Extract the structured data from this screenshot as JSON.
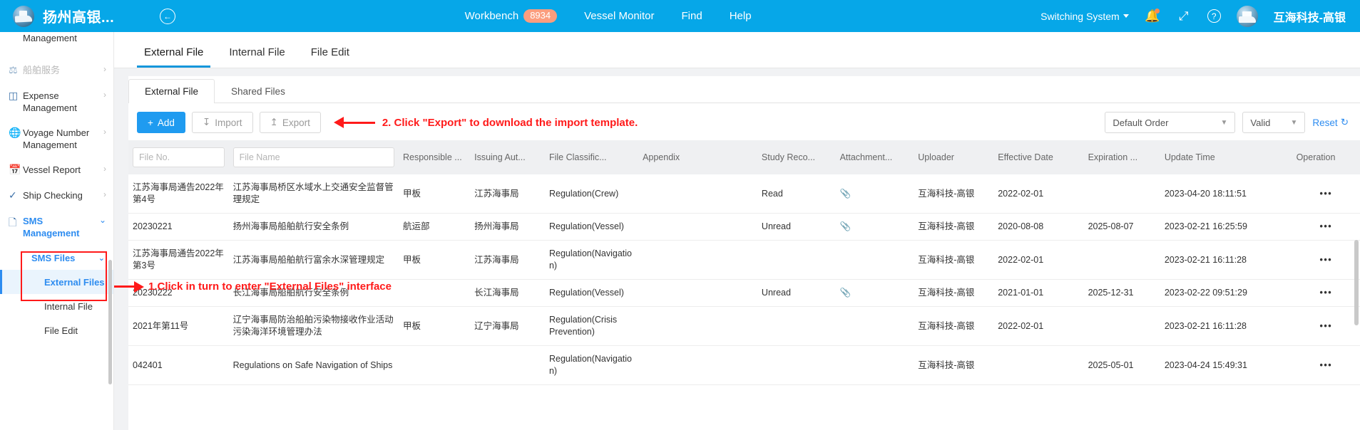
{
  "topbar": {
    "brand_name": "扬州高银...",
    "collapse_icon": "arrow-left-circle-icon",
    "nav": [
      {
        "label": "Workbench",
        "badge": "8934"
      },
      {
        "label": "Vessel Monitor",
        "badge": ""
      },
      {
        "label": "Find",
        "badge": ""
      },
      {
        "label": "Help",
        "badge": ""
      }
    ],
    "switch_system": "Switching System",
    "bell_icon": "bell-icon",
    "expand_icon": "fullscreen-icon",
    "help_icon": "question-circle-icon",
    "user_name": "互海科技-高银",
    "accent": "#06A7E8",
    "badge_color": "#FB9D7E"
  },
  "sidebar": {
    "items": [
      {
        "label": "Management",
        "icon": "",
        "arrow": "",
        "muted": false,
        "continuation": true
      },
      {
        "label": "船舶服务",
        "icon": "tool-icon",
        "arrow": "›",
        "muted": true,
        "continuation": false
      },
      {
        "label": "Expense Management",
        "icon": "database-icon",
        "arrow": "›",
        "muted": false,
        "continuation": false
      },
      {
        "label": "Voyage Number Management",
        "icon": "globe-icon",
        "arrow": "›",
        "muted": false,
        "continuation": false
      },
      {
        "label": "Vessel Report",
        "icon": "calendar-icon",
        "arrow": "›",
        "muted": false,
        "continuation": false
      },
      {
        "label": "Ship Checking",
        "icon": "check-circle-icon",
        "arrow": "›",
        "muted": false,
        "continuation": false
      }
    ],
    "sms_group": {
      "label": "SMS Management",
      "icon": "files-icon",
      "chevron": "⌄"
    },
    "sms_files": {
      "label": "SMS Files",
      "chevron": "⌄"
    },
    "leaves": [
      {
        "label": "External Files",
        "selected": true
      },
      {
        "label": "Internal File",
        "selected": false
      },
      {
        "label": "File Edit",
        "selected": false
      }
    ]
  },
  "page_tabs": [
    {
      "label": "External File",
      "active": true
    },
    {
      "label": "Internal File",
      "active": false
    },
    {
      "label": "File Edit",
      "active": false
    }
  ],
  "card_tabs": [
    {
      "label": "External File",
      "active": true
    },
    {
      "label": "Shared Files",
      "active": false
    }
  ],
  "toolbar": {
    "add_label": "Add",
    "add_icon": "plus-icon",
    "import_label": "Import",
    "import_icon": "download-icon",
    "export_label": "Export",
    "export_icon": "upload-icon",
    "sort_value": "Default Order",
    "status_value": "Valid",
    "reset_label": "Reset",
    "reset_icon": "refresh-icon"
  },
  "annotations": {
    "step1": "1.Click in turn to enter \"External Files\" interface",
    "step2": "2. Click \"Export\" to download the import template.",
    "color": "#ff1a1a"
  },
  "table": {
    "headers": [
      "File No.",
      "File Name",
      "Responsible ...",
      "Issuing Aut...",
      "File Classific...",
      "Appendix",
      "Study Reco...",
      "Attachment...",
      "Uploader",
      "Effective Date",
      "Expiration ...",
      "Update Time",
      "Operation"
    ],
    "filter_placeholders": {
      "file_no": "File No.",
      "file_name": "File Name"
    },
    "rows": [
      {
        "file_no": "江苏海事局通告2022年第4号",
        "file_name": "江苏海事局桥区水域水上交通安全监督管理规定",
        "responsible": "甲板",
        "issuing_authority": "江苏海事局",
        "classification": "Regulation(Crew)",
        "appendix": "",
        "study_record": "Read",
        "attachment": "paperclip-icon",
        "uploader": "互海科技-高银",
        "effective_date": "2022-02-01",
        "expiration_date": "",
        "update_time": "2023-04-20 18:11:51",
        "operation": "•••"
      },
      {
        "file_no": "20230221",
        "file_name": "扬州海事局船舶航行安全条例",
        "responsible": "航运部",
        "issuing_authority": "扬州海事局",
        "classification": "Regulation(Vessel)",
        "appendix": "",
        "study_record": "Unread",
        "attachment": "paperclip-icon",
        "uploader": "互海科技-高银",
        "effective_date": "2020-08-08",
        "expiration_date": "2025-08-07",
        "update_time": "2023-02-21 16:25:59",
        "operation": "•••"
      },
      {
        "file_no": "江苏海事局通告2022年第3号",
        "file_name": "江苏海事局船舶航行富余水深管理规定",
        "responsible": "甲板",
        "issuing_authority": "江苏海事局",
        "classification": "Regulation(Navigation)",
        "appendix": "",
        "study_record": "",
        "attachment": "",
        "uploader": "互海科技-高银",
        "effective_date": "2022-02-01",
        "expiration_date": "",
        "update_time": "2023-02-21 16:11:28",
        "operation": "•••"
      },
      {
        "file_no": "20230222",
        "file_name": "长江海事局船舶航行安全条例",
        "responsible": "",
        "issuing_authority": "长江海事局",
        "classification": "Regulation(Vessel)",
        "appendix": "",
        "study_record": "Unread",
        "attachment": "paperclip-icon",
        "uploader": "互海科技-高银",
        "effective_date": "2021-01-01",
        "expiration_date": "2025-12-31",
        "update_time": "2023-02-22 09:51:29",
        "operation": "•••"
      },
      {
        "file_no": "2021年第11号",
        "file_name": "辽宁海事局防治船舶污染物接收作业活动污染海洋环境管理办法",
        "responsible": "甲板",
        "issuing_authority": "辽宁海事局",
        "classification": "Regulation(Crisis Prevention)",
        "appendix": "",
        "study_record": "",
        "attachment": "",
        "uploader": "互海科技-高银",
        "effective_date": "2022-02-01",
        "expiration_date": "",
        "update_time": "2023-02-21 16:11:28",
        "operation": "•••"
      },
      {
        "file_no": "042401",
        "file_name": "Regulations on Safe Navigation of Ships",
        "responsible": "",
        "issuing_authority": "",
        "classification": "Regulation(Navigation)",
        "appendix": "",
        "study_record": "",
        "attachment": "",
        "uploader": "互海科技-高银",
        "effective_date": "",
        "expiration_date": "2025-05-01",
        "update_time": "2023-04-24 15:49:31",
        "operation": "•••"
      }
    ]
  }
}
